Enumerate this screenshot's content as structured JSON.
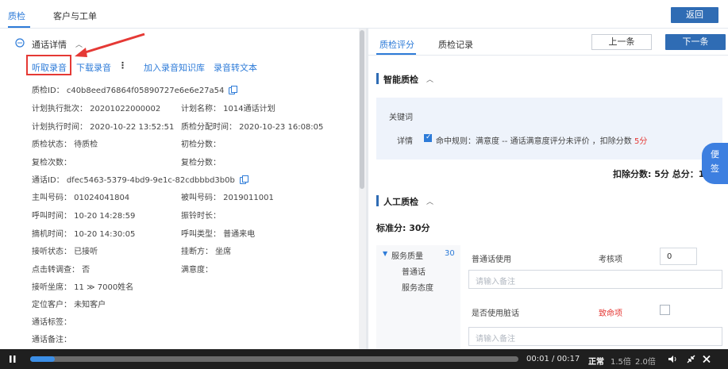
{
  "top_tabs": [
    {
      "label": "质检"
    },
    {
      "label": "客户与工单"
    }
  ],
  "back_button": "返回",
  "left": {
    "section_title": "通话详情",
    "actions": {
      "listen": "听取录音",
      "download": "下载录音",
      "more": "⋮",
      "add_kb": "加入录音知识库",
      "to_text": "录音转文本"
    },
    "fields": {
      "qc_id": "质检ID： c40b8eed76864f05890727e6e6e27a54",
      "plan_batch": "计划执行批次： 20201022000002",
      "plan_name": "计划名称： 1014通话计划",
      "plan_time": "计划执行时间： 2020-10-22 13:52:51",
      "qc_assign_time": "质检分配时间： 2020-10-23 16:08:05",
      "qc_status": "质检状态： 待质检",
      "first_score": "初检分数：",
      "recheck_count": "复检次数：",
      "recheck_score": "复检分数：",
      "call_id": "通话ID： dfec5463-5379-4bd9-9e1c-82cdbbbd3b0b",
      "caller": "主叫号码： 01024041804",
      "callee": "被叫号码： 2019011001",
      "call_time": "呼叫时间： 10-20 14:28:59",
      "ring_duration": "振铃时长：",
      "hangup_time": "摘机时间： 10-20 14:30:05",
      "call_type": "呼叫类型： 普通来电",
      "answer_status": "接听状态： 已接听",
      "hangup_side": "挂断方： 坐席",
      "survey": "点击转调查： 否",
      "satisfaction": "满意度：",
      "agent": "接听坐席： 11 ≫ 7000姓名",
      "locate_customer": "定位客户： 未知客户",
      "call_tags": "通话标签：",
      "call_notes": "通话备注："
    }
  },
  "right": {
    "tabs": [
      {
        "label": "质检评分"
      },
      {
        "label": "质检记录"
      }
    ],
    "prev_button": "上一条",
    "next_button": "下一条",
    "smart_title": "智能质检",
    "keyword_label": "关键词",
    "detail_label": "详情",
    "rule_text": "命中规则：满意度 -- 通话满意度评分未评价 ，扣除分数",
    "rule_score": "5分",
    "deduct_summary": "扣除分数: 5分 总分：100分",
    "manual_title": "人工质检",
    "standard_score": "标准分: 30分",
    "tree": {
      "group": "服务质量",
      "group_score": "30",
      "children": [
        "普通话",
        "服务态度"
      ]
    },
    "items": [
      {
        "name": "普通话使用",
        "type": "考核项",
        "value": "0",
        "note_placeholder": "请输入备注"
      },
      {
        "name": "是否使用脏话",
        "type": "致命项",
        "note_placeholder": "请输入备注"
      }
    ]
  },
  "float_tool": {
    "line1": "便",
    "line2": "签"
  },
  "player": {
    "progress": 0.05,
    "time": "00:01 / 00:17",
    "speed_normal": "正常",
    "speed_15": "1.5倍",
    "speed_2": "2.0倍"
  },
  "colors": {
    "accent": "#2d7bd8",
    "primary_button": "#2f6cb4",
    "fatal": "#e53935",
    "highlight_box": "#e53935"
  }
}
